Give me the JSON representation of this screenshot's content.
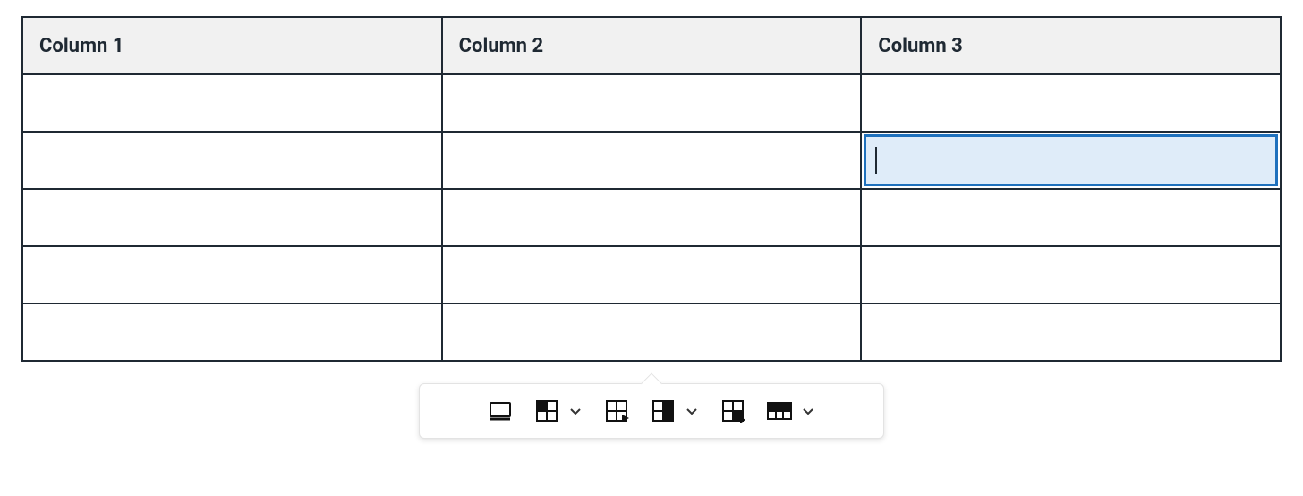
{
  "table": {
    "columns": [
      "Column 1",
      "Column 2",
      "Column 3"
    ],
    "rows": [
      [
        "",
        "",
        ""
      ],
      [
        "",
        "",
        ""
      ],
      [
        "",
        "",
        ""
      ],
      [
        "",
        "",
        ""
      ],
      [
        "",
        "",
        ""
      ]
    ],
    "selected_cell": {
      "row": 1,
      "col": 2
    }
  },
  "toolbar": {
    "items": [
      {
        "name": "table-properties-icon"
      },
      {
        "name": "table-cell-properties-icon",
        "chevron": true
      },
      {
        "name": "insert-row-icon"
      },
      {
        "name": "insert-column-icon",
        "chevron": true
      },
      {
        "name": "merge-cells-icon"
      },
      {
        "name": "table-header-icon",
        "chevron": true
      }
    ]
  }
}
